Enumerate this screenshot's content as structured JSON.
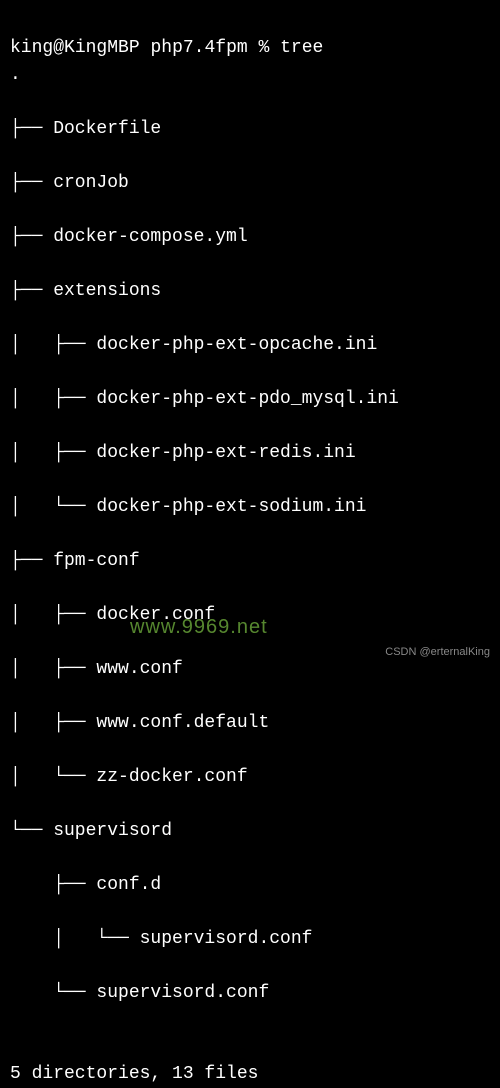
{
  "prompt": {
    "user": "king",
    "host": "KingMBP",
    "path": "php7.4fpm",
    "symbol": "%",
    "command": "tree"
  },
  "tree": {
    "root": ".",
    "lines": [
      "├── Dockerfile",
      "├── cronJob",
      "├── docker-compose.yml",
      "├── extensions",
      "│   ├── docker-php-ext-opcache.ini",
      "│   ├── docker-php-ext-pdo_mysql.ini",
      "│   ├── docker-php-ext-redis.ini",
      "│   └── docker-php-ext-sodium.ini",
      "├── fpm-conf",
      "│   ├── docker.conf",
      "│   ├── www.conf",
      "│   ├── www.conf.default",
      "│   └── zz-docker.conf",
      "└── supervisord",
      "    ├── conf.d",
      "    │   └── supervisord.conf",
      "    └── supervisord.conf"
    ],
    "summary": "5 directories, 13 files"
  },
  "watermarks": {
    "site": "www.9969.net",
    "author": "CSDN @erternalKing"
  }
}
